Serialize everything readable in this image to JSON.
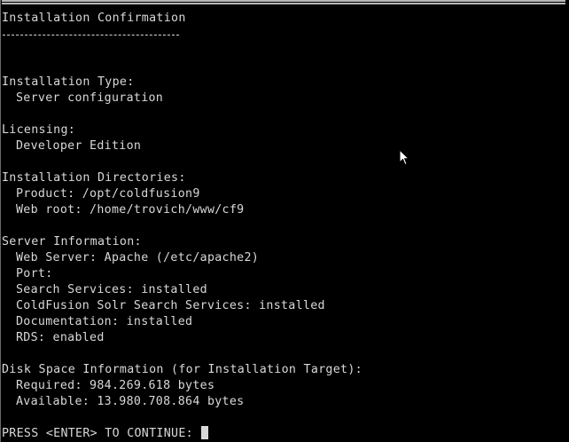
{
  "title": "Installation Confirmation",
  "installation_type": {
    "label": "Installation Type:",
    "value": "Server configuration"
  },
  "licensing": {
    "label": "Licensing:",
    "value": "Developer Edition"
  },
  "directories": {
    "label": "Installation Directories:",
    "product": "Product: /opt/coldfusion9",
    "web_root": "Web root: /home/trovich/www/cf9"
  },
  "server_info": {
    "label": "Server Information:",
    "web_server": "Web Server: Apache (/etc/apache2)",
    "port": "Port:",
    "search_services": "Search Services: installed",
    "solr_services": "ColdFusion Solr Search Services: installed",
    "documentation": "Documentation: installed",
    "rds": "RDS: enabled"
  },
  "disk_space": {
    "label": "Disk Space Information (for Installation Target):",
    "required": "Required: 984.269.618 bytes",
    "available": "Available: 13.980.708.864 bytes"
  },
  "prompt": "PRESS <ENTER> TO CONTINUE: ",
  "colors": {
    "background": "#000000",
    "foreground": "#d8d8d8"
  },
  "icons": {
    "mouse": "mouse-pointer-icon",
    "cursor": "text-cursor-block"
  }
}
